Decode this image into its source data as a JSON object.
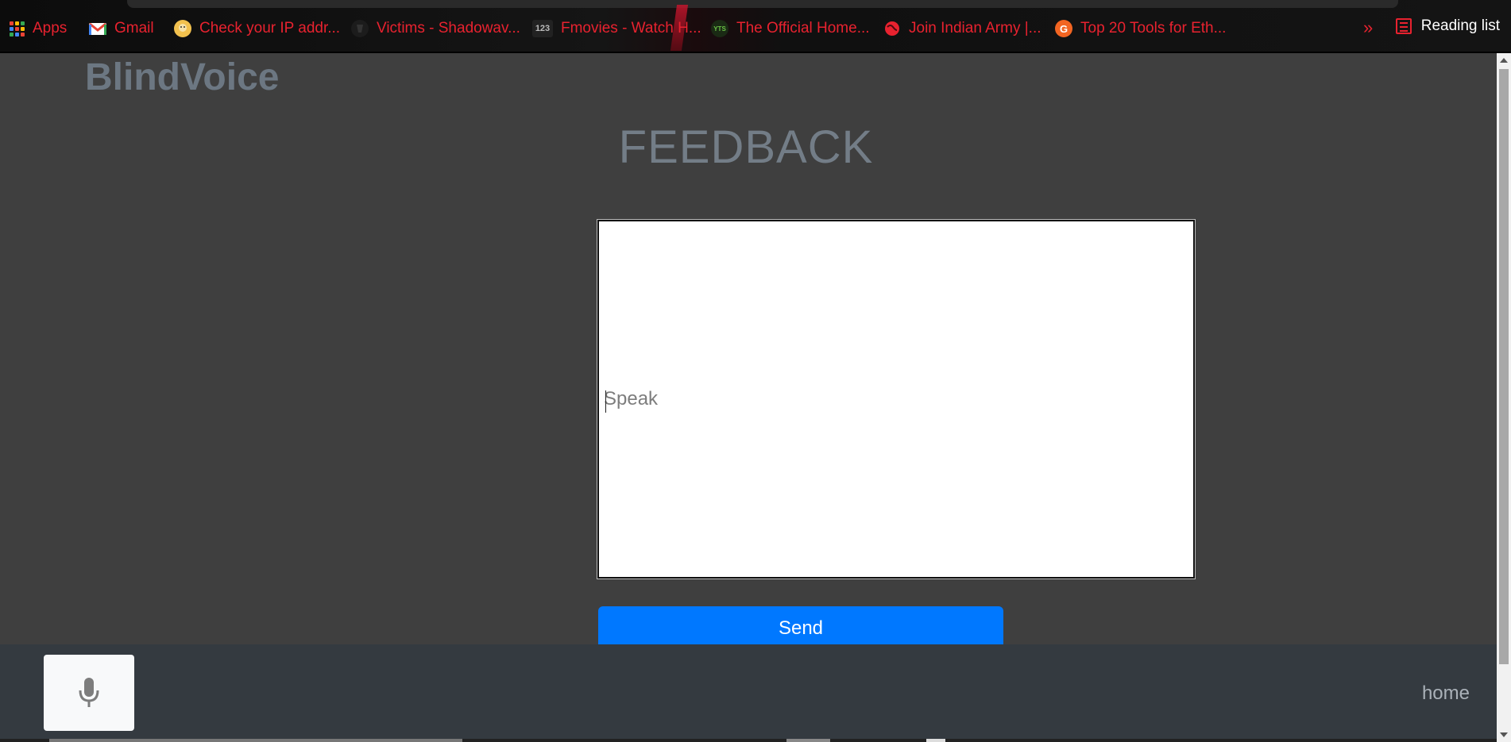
{
  "bookmarks": {
    "items": [
      {
        "label": "Apps",
        "icon": "apps-grid-icon"
      },
      {
        "label": "Gmail",
        "icon": "gmail-icon"
      },
      {
        "label": "Check your IP addr...",
        "icon": "ip-check-icon"
      },
      {
        "label": "Victims - Shadowav...",
        "icon": "shadow-icon"
      },
      {
        "label": "Fmovies - Watch H...",
        "icon": "fmovies-icon"
      },
      {
        "label": "The Official Home...",
        "icon": "yts-icon"
      },
      {
        "label": "Join Indian Army |...",
        "icon": "globe-icon"
      },
      {
        "label": "Top 20 Tools for Eth...",
        "icon": "g-circle-icon"
      }
    ],
    "more": "»",
    "reading_list": "Reading list",
    "icon_texts": {
      "fmovies": "123",
      "yts": "YTS",
      "g": "G"
    }
  },
  "brand": "BlindVoice",
  "title": "FEEDBACK",
  "feedback": {
    "placeholder": "Speak",
    "value": ""
  },
  "send_label": "Send",
  "footer": {
    "home": "home",
    "mic_icon": "microphone-icon"
  },
  "colors": {
    "bookmark_text": "#e8222f",
    "page_bg": "#3f3f3f",
    "footer_bg": "#343a40",
    "send_btn": "#0078ff",
    "brand": "#6c7782"
  }
}
